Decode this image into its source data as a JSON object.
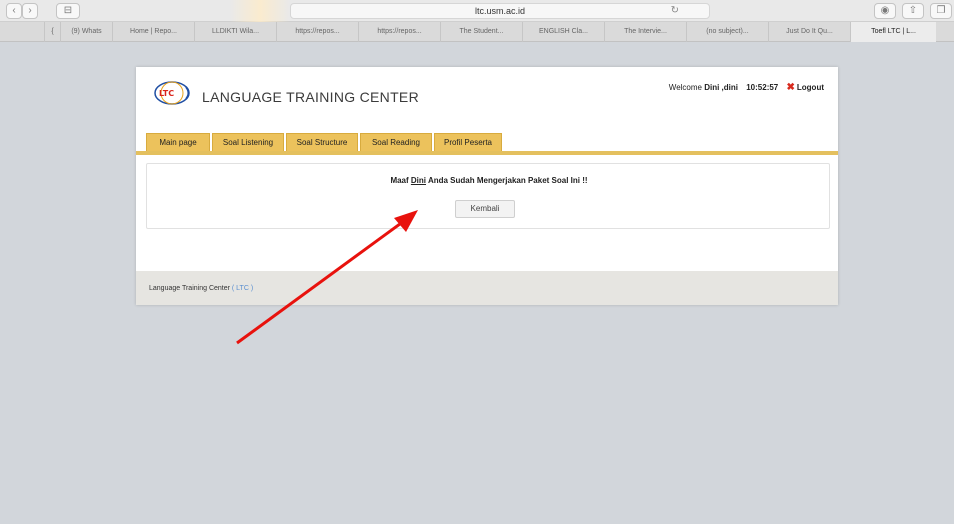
{
  "browser": {
    "url": "ltc.usm.ac.id",
    "sidebar_toggle_glyph": "⊟",
    "reader_glyph": "◉",
    "tabs": [
      "{",
      "(9) Whats",
      "Home | Repo...",
      "LLDIKTI Wila...",
      "https://repos...",
      "https://repos...",
      "The Student...",
      "ENGLISH Cla...",
      "The Intervie...",
      "(no subject)...",
      "Just Do It Qu...",
      "Toefl LTC | L..."
    ]
  },
  "header": {
    "brand": "LANGUAGE TRAINING CENTER",
    "logo_text": "LTC",
    "welcome_label": "Welcome",
    "user": "Dini ,dini",
    "time": "10:52:57",
    "logout": "Logout"
  },
  "nav": {
    "tabs": [
      "Main page",
      "Soal Listening",
      "Soal Structure",
      "Soal Reading",
      "Profil Peserta"
    ]
  },
  "message": {
    "prefix": "Maaf",
    "name": "Dini",
    "suffix": "Anda Sudah Mengerjakan Paket Soal Ini !!",
    "button": "Kembali"
  },
  "footer": {
    "text": "Language Training Center",
    "ltc_link": "( LTC )"
  },
  "colors": {
    "tab_yellow": "#ecc25c",
    "nav_line": "#e4c05e",
    "logout_x": "#d82b1f",
    "arrow": "#e8120d",
    "footer_link": "#5a8fd0"
  },
  "icons": {
    "back": "chevron-left-icon",
    "forward": "chevron-right-icon",
    "sidebar": "sidebar-icon",
    "reload": "reload-icon",
    "share": "share-icon",
    "logout": "close-x-icon"
  }
}
